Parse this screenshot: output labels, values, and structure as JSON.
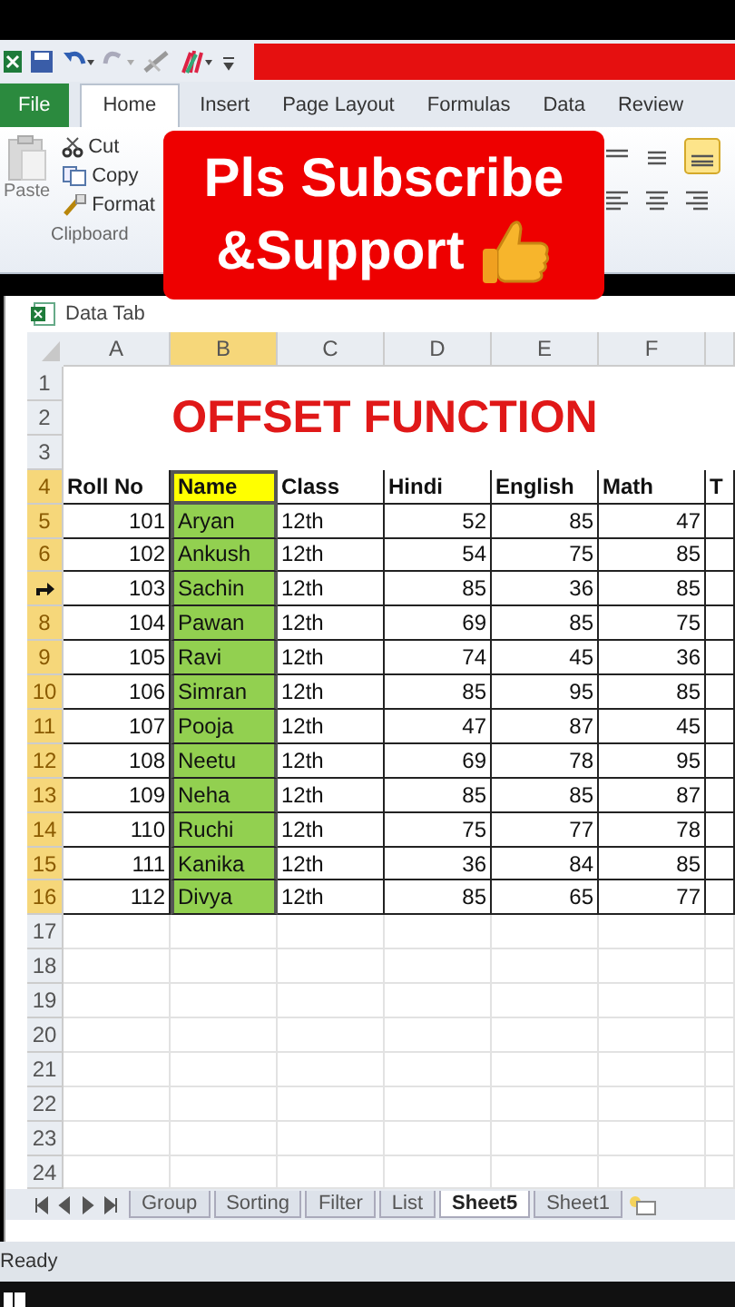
{
  "ribbon_tabs": [
    {
      "label": "File",
      "kind": "file",
      "selected": false
    },
    {
      "label": "Home",
      "kind": "tab",
      "selected": true
    },
    {
      "label": "Insert",
      "kind": "tab",
      "selected": false
    },
    {
      "label": "Page Layout",
      "kind": "tab",
      "selected": false
    },
    {
      "label": "Formulas",
      "kind": "tab",
      "selected": false
    },
    {
      "label": "Data",
      "kind": "tab",
      "selected": false
    },
    {
      "label": "Review",
      "kind": "tab",
      "selected": false
    }
  ],
  "clipboard": {
    "paste": "Paste",
    "cut": "Cut",
    "copy": "Copy",
    "format": "Format",
    "group_label": "Clipboard"
  },
  "banner": {
    "line_1": "Pls Subscribe",
    "line_2": "&Support"
  },
  "workbook": {
    "title": "Data Tab"
  },
  "columns": [
    {
      "label": "A",
      "selected": false
    },
    {
      "label": "B",
      "selected": true
    },
    {
      "label": "C",
      "selected": false
    },
    {
      "label": "D",
      "selected": false
    },
    {
      "label": "E",
      "selected": false
    },
    {
      "label": "F",
      "selected": false
    }
  ],
  "sheet_title": "OFFSET FUNCTION",
  "rows": [
    {
      "kind": "number",
      "header": "1",
      "selected": false,
      "cells": []
    },
    {
      "kind": "number",
      "header": "2",
      "selected": false,
      "cells": []
    },
    {
      "kind": "number",
      "header": "3",
      "selected": false,
      "cells": []
    },
    {
      "kind": "number",
      "header": "4",
      "selected": true,
      "cells": [
        "Roll No",
        "Name",
        "Class",
        "Hindi",
        "English",
        "Math",
        "T"
      ]
    },
    {
      "kind": "number",
      "header": "5",
      "selected": true,
      "cells": [
        "101",
        "Aryan",
        "12th",
        "52",
        "85",
        "47"
      ]
    },
    {
      "kind": "number",
      "header": "6",
      "selected": true,
      "cells": [
        "102",
        "Ankush",
        "12th",
        "54",
        "75",
        "85"
      ]
    },
    {
      "kind": "cursor",
      "selected": true,
      "cells": [
        "103",
        "Sachin",
        "12th",
        "85",
        "36",
        "85"
      ]
    },
    {
      "kind": "number",
      "header": "8",
      "selected": true,
      "cells": [
        "104",
        "Pawan",
        "12th",
        "69",
        "85",
        "75"
      ]
    },
    {
      "kind": "number",
      "header": "9",
      "selected": true,
      "cells": [
        "105",
        "Ravi",
        "12th",
        "74",
        "45",
        "36"
      ]
    },
    {
      "kind": "number",
      "header": "10",
      "selected": true,
      "cells": [
        "106",
        "Simran",
        "12th",
        "85",
        "95",
        "85"
      ]
    },
    {
      "kind": "number",
      "header": "11",
      "selected": true,
      "cells": [
        "107",
        "Pooja",
        "12th",
        "47",
        "87",
        "45"
      ]
    },
    {
      "kind": "number",
      "header": "12",
      "selected": true,
      "cells": [
        "108",
        "Neetu",
        "12th",
        "69",
        "78",
        "95"
      ]
    },
    {
      "kind": "number",
      "header": "13",
      "selected": true,
      "cells": [
        "109",
        "Neha",
        "12th",
        "85",
        "85",
        "87"
      ]
    },
    {
      "kind": "number",
      "header": "14",
      "selected": true,
      "cells": [
        "110",
        "Ruchi",
        "12th",
        "75",
        "77",
        "78"
      ]
    },
    {
      "kind": "number",
      "header": "15",
      "selected": true,
      "cells": [
        "111",
        "Kanika",
        "12th",
        "36",
        "84",
        "85"
      ]
    },
    {
      "kind": "number",
      "header": "16",
      "selected": true,
      "cells": [
        "112",
        "Divya",
        "12th",
        "85",
        "65",
        "77"
      ]
    },
    {
      "kind": "number",
      "header": "17",
      "selected": false,
      "cells": []
    },
    {
      "kind": "number",
      "header": "18",
      "selected": false,
      "cells": []
    },
    {
      "kind": "number",
      "header": "19",
      "selected": false,
      "cells": []
    },
    {
      "kind": "number",
      "header": "20",
      "selected": false,
      "cells": []
    },
    {
      "kind": "number",
      "header": "21",
      "selected": false,
      "cells": []
    },
    {
      "kind": "number",
      "header": "22",
      "selected": false,
      "cells": []
    },
    {
      "kind": "number",
      "header": "23",
      "selected": false,
      "cells": []
    },
    {
      "kind": "number",
      "header": "24",
      "selected": false,
      "cells": []
    }
  ],
  "sheet_tabs": [
    {
      "label": "Group",
      "selected": false
    },
    {
      "label": "Sorting",
      "selected": false
    },
    {
      "label": "Filter",
      "selected": false
    },
    {
      "label": "List",
      "selected": false
    },
    {
      "label": "Sheet5",
      "selected": true
    },
    {
      "label": "Sheet1",
      "selected": false
    }
  ],
  "status_bar": {
    "text": "Ready"
  }
}
